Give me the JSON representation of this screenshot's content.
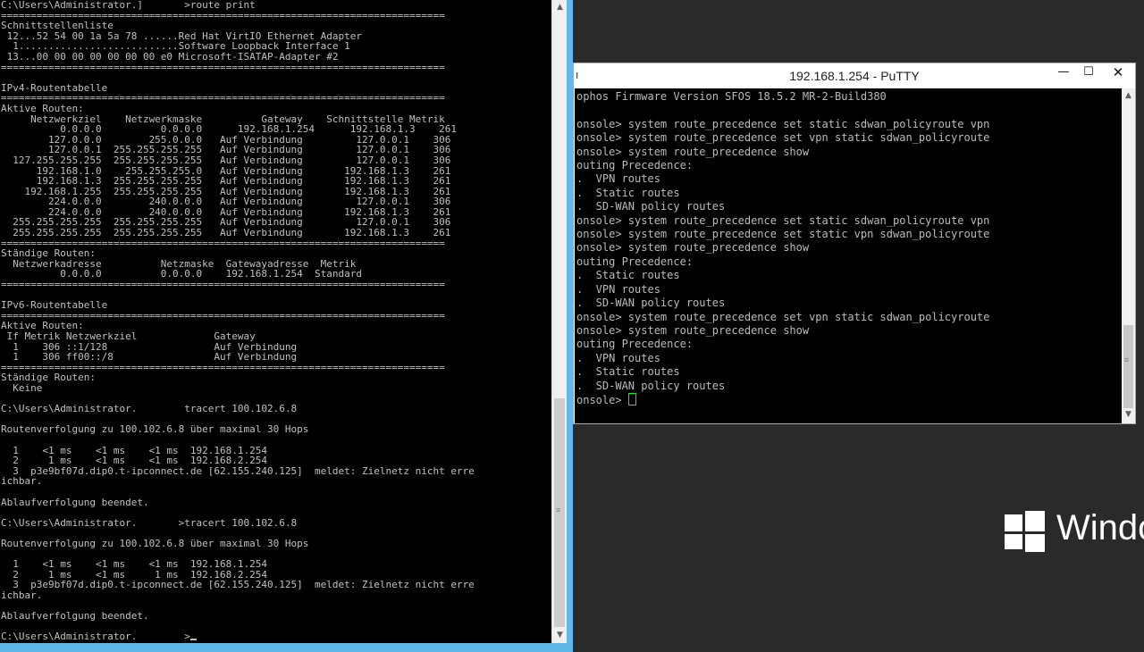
{
  "cmd": {
    "lines": [
      "C:\\Users\\Administrator.]       >route print",
      "===========================================================================",
      "Schnittstellenliste",
      " 12...52 54 00 1a 5a 78 ......Red Hat VirtIO Ethernet Adapter",
      "  1...........................Software Loopback Interface 1",
      " 13...00 00 00 00 00 00 00 e0 Microsoft-ISATAP-Adapter #2",
      "===========================================================================",
      "",
      "IPv4-Routentabelle",
      "===========================================================================",
      "Aktive Routen:",
      "     Netzwerkziel    Netzwerkmaske          Gateway    Schnittstelle Metrik",
      "          0.0.0.0          0.0.0.0      192.168.1.254      192.168.1.3    261",
      "        127.0.0.0        255.0.0.0   Auf Verbindung         127.0.0.1    306",
      "        127.0.0.1  255.255.255.255   Auf Verbindung         127.0.0.1    306",
      "  127.255.255.255  255.255.255.255   Auf Verbindung         127.0.0.1    306",
      "      192.168.1.0    255.255.255.0   Auf Verbindung       192.168.1.3    261",
      "      192.168.1.3  255.255.255.255   Auf Verbindung       192.168.1.3    261",
      "    192.168.1.255  255.255.255.255   Auf Verbindung       192.168.1.3    261",
      "        224.0.0.0        240.0.0.0   Auf Verbindung         127.0.0.1    306",
      "        224.0.0.0        240.0.0.0   Auf Verbindung       192.168.1.3    261",
      "  255.255.255.255  255.255.255.255   Auf Verbindung         127.0.0.1    306",
      "  255.255.255.255  255.255.255.255   Auf Verbindung       192.168.1.3    261",
      "===========================================================================",
      "Ständige Routen:",
      "  Netzwerkadresse          Netzmaske  Gatewayadresse  Metrik",
      "          0.0.0.0          0.0.0.0    192.168.1.254  Standard",
      "===========================================================================",
      "",
      "IPv6-Routentabelle",
      "===========================================================================",
      "Aktive Routen:",
      " If Metrik Netzwerkziel             Gateway",
      "  1    306 ::1/128                  Auf Verbindung",
      "  1    306 ff00::/8                 Auf Verbindung",
      "===========================================================================",
      "Ständige Routen:",
      "  Keine",
      "",
      "C:\\Users\\Administrator.        tracert 100.102.6.8",
      "",
      "Routenverfolgung zu 100.102.6.8 über maximal 30 Hops",
      "",
      "  1    <1 ms    <1 ms    <1 ms  192.168.1.254",
      "  2     1 ms    <1 ms    <1 ms  192.168.2.254",
      "  3  p3e9bf07d.dip0.t-ipconnect.de [62.155.240.125]  meldet: Zielnetz nicht erre",
      "ichbar.",
      "",
      "Ablaufverfolgung beendet.",
      "",
      "C:\\Users\\Administrator.       >tracert 100.102.6.8",
      "",
      "Routenverfolgung zu 100.102.6.8 über maximal 30 Hops",
      "",
      "  1    <1 ms    <1 ms    <1 ms  192.168.1.254",
      "  2     1 ms    <1 ms     1 ms  192.168.2.254",
      "  3  p3e9bf07d.dip0.t-ipconnect.de [62.155.240.125]  meldet: Zielnetz nicht erre",
      "ichbar.",
      "",
      "Ablaufverfolgung beendet.",
      ""
    ],
    "prompt": "C:\\Users\\Administrator.        >"
  },
  "putty": {
    "title": "192.168.1.254 - PuTTY",
    "minimize_glyph": "—",
    "maximize_glyph": "☐",
    "close_glyph": "✕",
    "lines": [
      "ophos Firmware Version SFOS 18.5.2 MR-2-Build380",
      "",
      "onsole> system route_precedence set static sdwan_policyroute vpn",
      "onsole> system route_precedence set vpn static sdwan_policyroute",
      "onsole> system route_precedence show",
      "outing Precedence:",
      ".  VPN routes",
      ".  Static routes",
      ".  SD-WAN policy routes",
      "onsole> system route_precedence set static sdwan_policyroute vpn",
      "onsole> system route_precedence set static vpn sdwan_policyroute",
      "onsole> system route_precedence show",
      "outing Precedence:",
      ".  Static routes",
      ".  VPN routes",
      ".  SD-WAN policy routes",
      "onsole> system route_precedence set vpn static sdwan_policyroute",
      "onsole> system route_precedence show",
      "outing Precedence:",
      ".  VPN routes",
      ".  Static routes",
      ".  SD-WAN policy routes"
    ],
    "prompt": "onsole> "
  },
  "desktop": {
    "windows_text": "Windo"
  },
  "colors": {
    "console_bg": "#000000",
    "console_text": "#c0c0c0",
    "window_frame": "#5fb8ea",
    "cursor": "#00ff00"
  },
  "icons": {
    "scroll_up": "▲",
    "scroll_down": "▼",
    "grip": "≡"
  }
}
